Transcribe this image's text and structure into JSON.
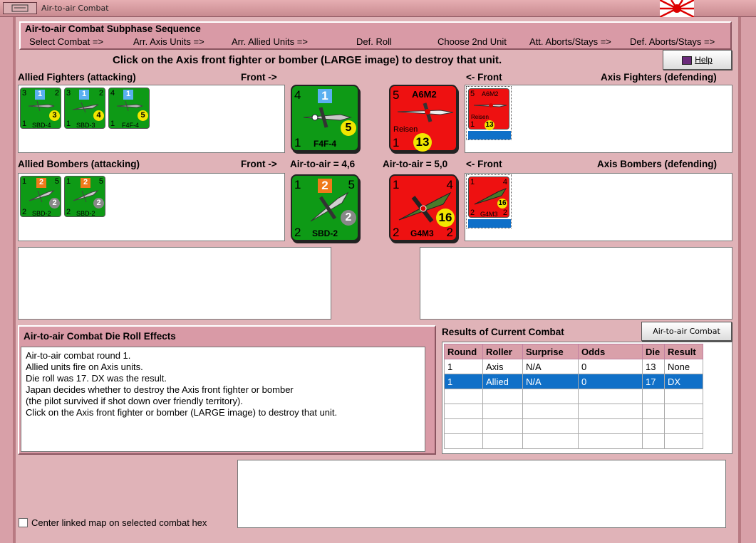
{
  "window": {
    "title": "Air-to-air Combat"
  },
  "subphase": {
    "title": "Air-to-air Combat Subphase Sequence",
    "steps": [
      "Select Combat =>",
      "Arr. Axis Units =>",
      "Arr. Allied Units =>",
      "Def. Roll",
      "Choose 2nd Unit",
      "Att. Aborts/Stays =>",
      "Def. Aborts/Stays =>"
    ]
  },
  "instruction": "Click on the Axis front fighter or bomber (LARGE image) to destroy that unit.",
  "help_label": "Help",
  "allied_fighters": {
    "label": "Allied Fighters (attacking)",
    "front_label": "Front ->",
    "units": [
      {
        "name": "SBD-4",
        "top_left": "3",
        "top_right": "2",
        "bottom_left": "1",
        "badge": "1",
        "disc": "3"
      },
      {
        "name": "SBD-3",
        "top_left": "3",
        "top_right": "2",
        "bottom_left": "1",
        "badge": "1",
        "disc": "4"
      },
      {
        "name": "F4F-4",
        "top_left": "4",
        "top_right": "",
        "bottom_left": "1",
        "badge": "1",
        "disc": "5"
      }
    ],
    "front_unit": {
      "name": "F4F-4",
      "top_left": "4",
      "bottom_left": "1",
      "badge": "1",
      "disc": "5"
    }
  },
  "axis_fighters": {
    "label": "Axis Fighters (defending)",
    "front_label": "<- Front",
    "front_unit": {
      "name": "A6M2",
      "sub": "Reisen",
      "top_left": "5",
      "bottom_left": "1",
      "disc": "13"
    },
    "units": [
      {
        "name": "A6M2",
        "sub": "Reisen",
        "top_left": "5",
        "bottom_left": "1",
        "disc": "13"
      }
    ]
  },
  "allied_bombers": {
    "label": "Allied Bombers (attacking)",
    "front_label": "Front ->",
    "air_to_air": "Air-to-air = 4,6",
    "units": [
      {
        "name": "SBD-2",
        "top_left": "1",
        "top_right": "5",
        "bottom_left": "2",
        "badge": "2",
        "disc": "2"
      },
      {
        "name": "SBD-2",
        "top_left": "1",
        "top_right": "5",
        "bottom_left": "2",
        "badge": "2",
        "disc": "2"
      }
    ],
    "front_unit": {
      "name": "SBD-2",
      "top_left": "1",
      "top_right": "5",
      "bottom_left": "2",
      "badge": "2",
      "disc": "2"
    }
  },
  "axis_bombers": {
    "label": "Axis Bombers (defending)",
    "front_label": "<- Front",
    "air_to_air": "Air-to-air = 5,0",
    "front_unit": {
      "name": "G4M3",
      "top_left": "1",
      "top_right": "4",
      "bottom_left": "2",
      "bottom_right": "2",
      "disc": "16"
    },
    "units": [
      {
        "name": "G4M3",
        "top_left": "1",
        "top_right": "4",
        "bottom_left": "2",
        "bottom_right": "2",
        "disc": "16"
      }
    ]
  },
  "effects": {
    "title": "Air-to-air Combat Die Roll Effects",
    "lines": [
      "Air-to-air combat round 1.",
      "Allied units fire on Axis units.",
      "Die roll was 17.  DX was the result.",
      "Japan decides whether to destroy the Axis front fighter or bomber",
      "(the pilot survived if shot down over friendly territory).",
      "Click on the Axis front fighter or bomber (LARGE image) to destroy that unit."
    ]
  },
  "results": {
    "title": "Results of Current Combat",
    "chart_button": "Air-to-air Combat Chart",
    "columns": [
      "Round",
      "Roller",
      "Surprise",
      "Odds",
      "Die",
      "Result"
    ],
    "rows": [
      [
        "1",
        "Axis",
        "N/A",
        "0",
        "13",
        "None"
      ],
      [
        "1",
        "Allied",
        "N/A",
        "0",
        "17",
        "DX"
      ]
    ],
    "selected_row": 1
  },
  "center_map": {
    "label": "Center linked map on selected combat hex",
    "checked": false
  },
  "colors": {
    "allied": "#0e9a16",
    "axis": "#ee1111",
    "selection": "#1070c8",
    "disc": "#f2e600"
  }
}
